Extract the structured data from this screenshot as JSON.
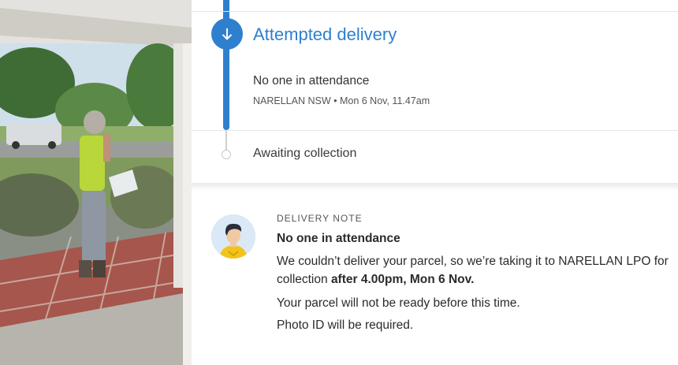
{
  "photo": {
    "description_icon": "person-delivering-parcel-photo"
  },
  "tracker": {
    "current_step": {
      "title": "Attempted delivery",
      "icon": "arrow-down-icon",
      "event": "No one in attendance",
      "location_time": "NARELLAN NSW • Mon 6 Nov, 11.47am"
    },
    "next_step": {
      "title": "Awaiting collection"
    },
    "accent_color": "#2f7fcf"
  },
  "delivery_note": {
    "label": "DELIVERY NOTE",
    "title": "No one in attendance",
    "body_prefix": "We couldn’t deliver your parcel, so we’re taking it to NARELLAN LPO for collection ",
    "body_bold": "after 4.00pm, Mon 6 Nov.",
    "line2": "Your parcel will not be ready before this time.",
    "line3": "Photo ID will be required."
  }
}
